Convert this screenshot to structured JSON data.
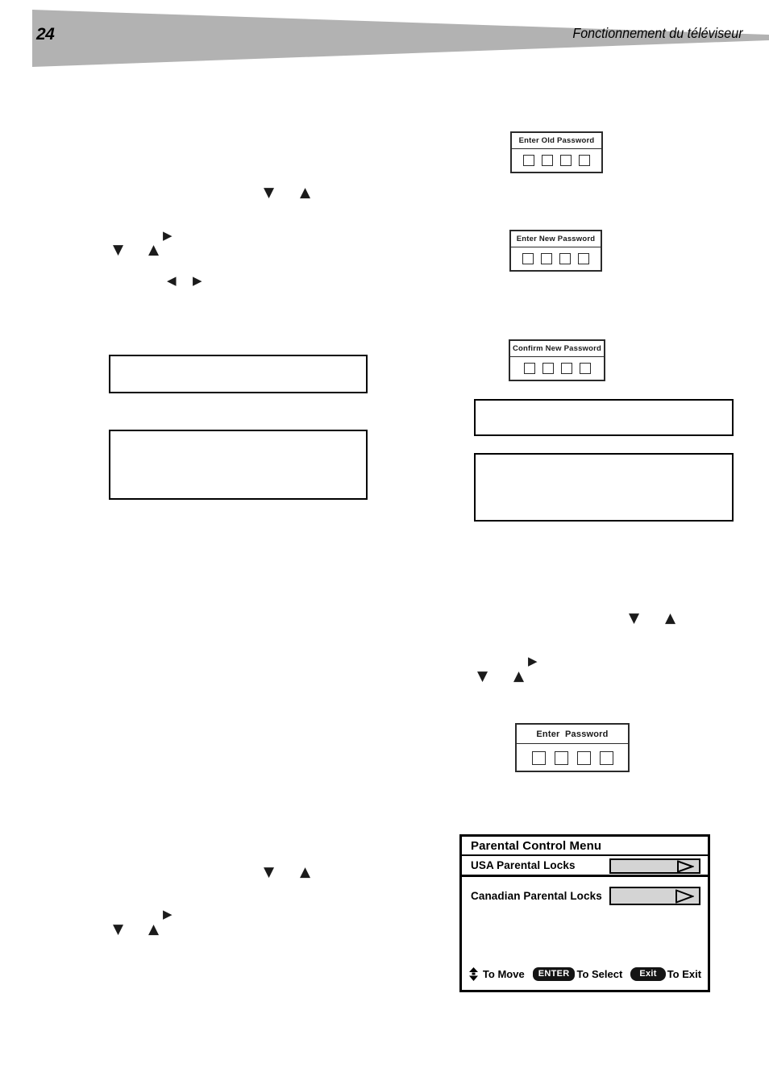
{
  "header": {
    "page_number": "24",
    "title": "Fonctionnement du téléviseur",
    "wedge_color": "#b2b2b2"
  },
  "dialogs": [
    {
      "name": "enter-old-password",
      "title": "Enter Old Password",
      "boxes": 4,
      "box_values": [
        "",
        "",
        "",
        ""
      ]
    },
    {
      "name": "enter-new-password",
      "title": "Enter New Password",
      "boxes": 4,
      "box_values": [
        "",
        "",
        "",
        ""
      ]
    },
    {
      "name": "confirm-new-password",
      "title": "Confirm New Password",
      "boxes": 4,
      "box_values": [
        "",
        "",
        "",
        ""
      ]
    },
    {
      "name": "enter-password",
      "title": "Enter  Password",
      "boxes": 4,
      "box_values": [
        "",
        "",
        "",
        ""
      ]
    }
  ],
  "note_frames": [
    {
      "name": "note-left-upper",
      "text": ""
    },
    {
      "name": "note-left-lower",
      "text": ""
    },
    {
      "name": "note-right-upper",
      "text": ""
    },
    {
      "name": "note-right-lower",
      "text": ""
    }
  ],
  "arrow_glyphs": {
    "down": "▼",
    "up": "▲",
    "right": "▶",
    "left": "◀"
  },
  "osd": {
    "title": "Parental Control Menu",
    "rows": [
      {
        "label": "USA Parental Locks",
        "selected": true,
        "control": "arrow-button"
      },
      {
        "label": "Canadian Parental Locks",
        "selected": false,
        "control": "arrow-button"
      }
    ],
    "footer": {
      "move_label": "To Move",
      "enter_key": "ENTER",
      "select_label": "To Select",
      "exit_key": "Exit",
      "exit_label": "To Exit"
    },
    "button_fill": "#d4d4d4",
    "border_color": "#000000"
  }
}
